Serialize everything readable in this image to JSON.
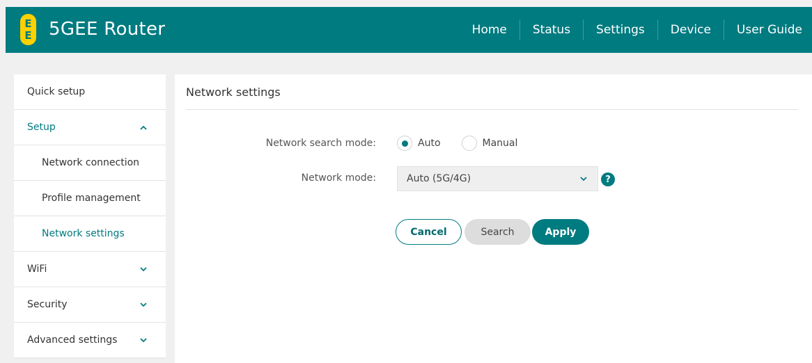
{
  "header": {
    "logo_top": "E",
    "logo_bottom": "E",
    "title": "5GEE Router",
    "nav": [
      "Home",
      "Status",
      "Settings",
      "Device",
      "User Guide"
    ]
  },
  "sidebar": {
    "items": [
      {
        "label": "Quick setup"
      },
      {
        "label": "Setup"
      },
      {
        "label": "Network connection"
      },
      {
        "label": "Profile management"
      },
      {
        "label": "Network settings"
      },
      {
        "label": "WiFi"
      },
      {
        "label": "Security"
      },
      {
        "label": "Advanced settings"
      }
    ]
  },
  "main": {
    "title": "Network settings",
    "search_mode_label": "Network search mode:",
    "search_mode_options": [
      "Auto",
      "Manual"
    ],
    "search_mode_selected": "Auto",
    "network_mode_label": "Network mode:",
    "network_mode_value": "Auto (5G/4G)",
    "help_glyph": "?",
    "buttons": {
      "cancel": "Cancel",
      "search": "Search",
      "apply": "Apply"
    }
  },
  "colors": {
    "brand": "#007b80",
    "logo": "#ffd100"
  }
}
